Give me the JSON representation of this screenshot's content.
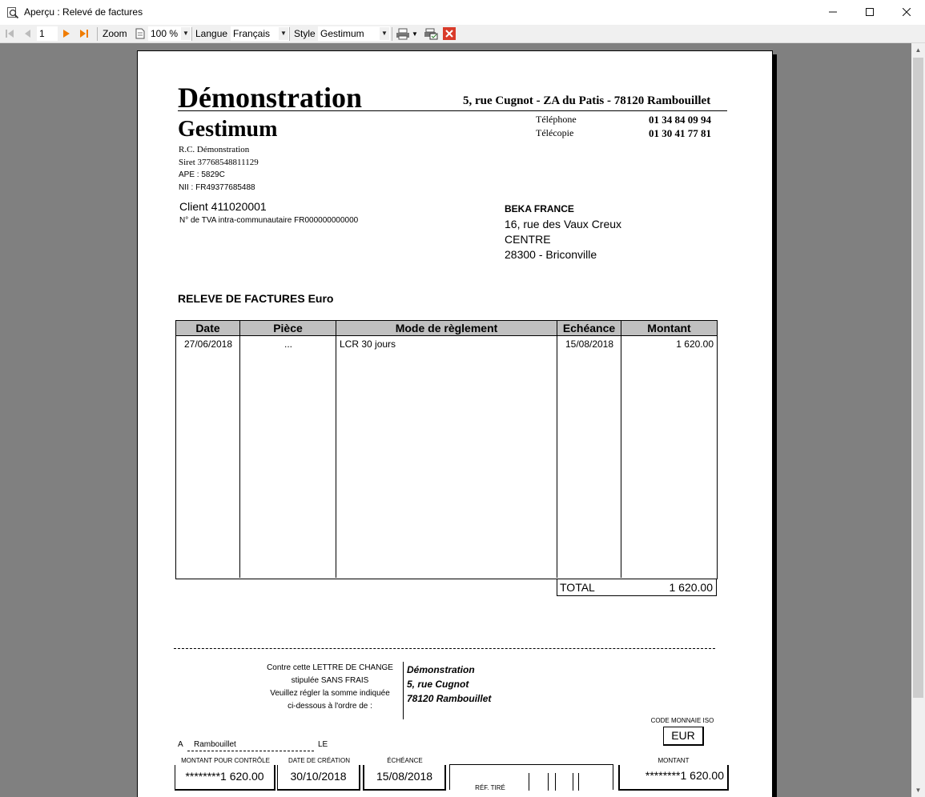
{
  "window": {
    "title": "Aperçu : Relevé de factures",
    "icons": {
      "app": "preview-icon",
      "minimize": "minimize-icon",
      "maximize": "maximize-icon",
      "close": "close-icon"
    }
  },
  "toolbar": {
    "page_number": "1",
    "zoom_label": "Zoom",
    "zoom_value": "100 %",
    "language_label": "Langue",
    "language_value": "Français",
    "style_label": "Style",
    "style_value": "Gestimum"
  },
  "company": {
    "name_line1": "Démonstration",
    "name_line2": "Gestimum",
    "address": "5, rue Cugnot - ZA du Patis - 78120 Rambouillet",
    "phone_label": "Téléphone",
    "phone": "01 34 84 09 94",
    "fax_label": "Télécopie",
    "fax": "01 30 41 77 81",
    "rc": "R.C. Démonstration",
    "siret": "Siret 37768548811129",
    "ape": "APE : 5829C",
    "nii": "NII : FR49377685488"
  },
  "client": {
    "label": "Client  411020001",
    "vat": "N° de TVA intra-communautaire FR000000000000"
  },
  "recipient": {
    "name": "BEKA FRANCE",
    "line1": "16, rue des Vaux Creux",
    "line2": "CENTRE",
    "line3": "28300 - Briconville"
  },
  "statement": {
    "title": "RELEVE DE FACTURES Euro",
    "headers": [
      "Date",
      "Pièce",
      "Mode de règlement",
      "Echéance",
      "Montant"
    ],
    "rows": [
      {
        "date": "27/06/2018",
        "piece": "...",
        "mode": "LCR 30 jours",
        "echeance": "15/08/2018",
        "montant": "1 620.00"
      }
    ],
    "total_label": "TOTAL",
    "total_value": "1 620.00"
  },
  "lcr": {
    "text_l1": "Contre cette LETTRE DE CHANGE",
    "text_l2": "stipulée SANS FRAIS",
    "text_l3": "Veuillez régler la somme indiquée",
    "text_l4": "ci-dessous à l'ordre de :",
    "payee_l1": "Démonstration",
    "payee_l2": "5, rue Cugnot",
    "payee_l3": "78120 Rambouillet",
    "currency_label": "CODE MONNAIE ISO",
    "currency": "EUR",
    "place_prefix": "A",
    "place": "Rambouillet",
    "le": "LE",
    "amount_ctrl_label": "MONTANT POUR CONTRÔLE",
    "amount_ctrl": "********1 620.00",
    "creation_label": "DATE DE CRÉATION",
    "creation": "30/10/2018",
    "due_label": "ÉCHÉANCE",
    "due": "15/08/2018",
    "ref_label": "RÉF. TIRÉ",
    "amount_label": "MONTANT",
    "amount": "********1 620.00"
  }
}
